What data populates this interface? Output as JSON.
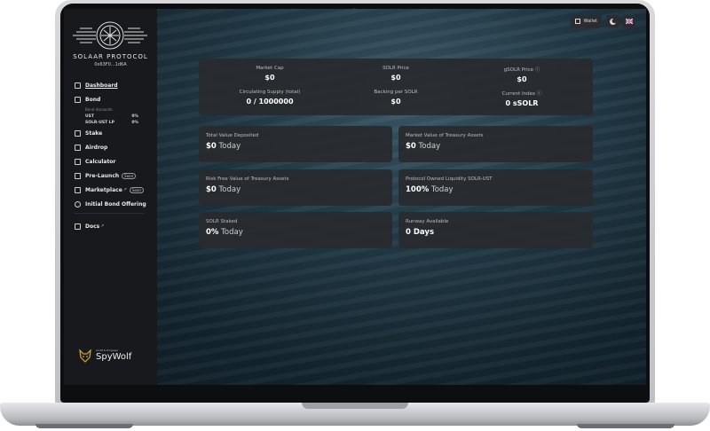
{
  "brand": {
    "name": "SOLAAR PROTOCOL",
    "address": "0x63F0...1d6A"
  },
  "sidebar": {
    "items": [
      {
        "label": "Dashboard",
        "icon": "dashboard-icon"
      },
      {
        "label": "Bond",
        "icon": "bond-icon"
      },
      {
        "label": "Stake",
        "icon": "stake-icon"
      },
      {
        "label": "Airdrop",
        "icon": "airdrop-icon"
      },
      {
        "label": "Calculator",
        "icon": "calculator-icon"
      },
      {
        "label": "Pre-Launch",
        "badge": "Soon",
        "icon": "pre-launch-icon"
      },
      {
        "label": "Marketplace",
        "ext": "↗",
        "badge": "Soon",
        "icon": "marketplace-icon"
      },
      {
        "label": "Initial Bond Offering",
        "icon": "ibo-icon"
      },
      {
        "label": "Docs",
        "ext": "↗",
        "icon": "docs-icon"
      }
    ],
    "bond_discounts": {
      "title": "Bond discounts",
      "rows": [
        {
          "name": "UST",
          "value": "0%"
        },
        {
          "name": "SOLR-UST LP",
          "value": "0%"
        }
      ]
    },
    "audit": {
      "label": "Audit & Progress",
      "name": "SpyWolf"
    }
  },
  "header": {
    "wallet_label": "Wallet"
  },
  "stats": [
    {
      "label": "Market Cap",
      "value": "$0"
    },
    {
      "label": "SOLR Price",
      "value": "$0"
    },
    {
      "label": "gSOLR Price ⓘ",
      "value": "$0"
    },
    {
      "label": "Circulating Supply (total)",
      "value": "0 / 1000000"
    },
    {
      "label": "Backing per SOLR",
      "value": "$0"
    },
    {
      "label": "Current Index ⓘ",
      "value": "0 sSOLR"
    }
  ],
  "metrics": [
    {
      "label": "Total Value Deposited",
      "value": "$0",
      "suffix": " Today"
    },
    {
      "label": "Market Value of Treasury Assets",
      "value": "$0",
      "suffix": " Today"
    },
    {
      "label": "Risk Free Value of Treasury Assets",
      "value": "$0",
      "suffix": " Today"
    },
    {
      "label": "Protocol Owned Liquidity SOLR-UST",
      "value": "100%",
      "suffix": " Today"
    },
    {
      "label": "SOLR Staked",
      "value": "0%",
      "suffix": " Today"
    },
    {
      "label": "Runway Available",
      "value": "0 Days",
      "suffix": ""
    }
  ],
  "colors": {
    "card": "#28292e",
    "sidebar": "#17191c",
    "text": "#ffffff"
  }
}
